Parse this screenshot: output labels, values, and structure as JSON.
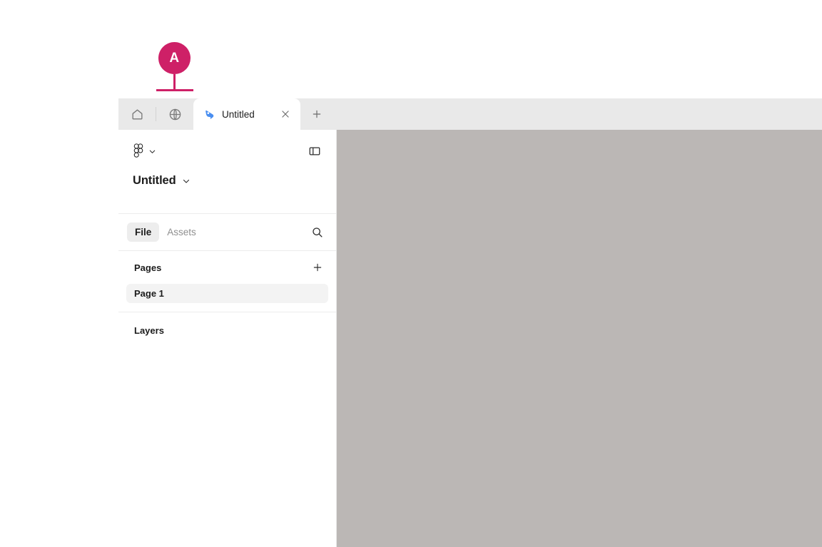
{
  "annotation": {
    "label": "A",
    "color": "#CE2067"
  },
  "browser": {
    "home_icon": "home-icon",
    "globe_icon": "globe-icon",
    "tab": {
      "favicon": "penpot-logo-icon",
      "title": "Untitled",
      "close_icon": "close-icon"
    },
    "new_tab_icon": "plus-icon"
  },
  "sidebar": {
    "brand": {
      "logo_icon": "figma-logo-icon",
      "chevron_icon": "chevron-down-icon"
    },
    "panel_toggle_icon": "panel-left-toggle-icon",
    "file": {
      "name": "Untitled",
      "chevron_icon": "chevron-down-icon"
    },
    "tabs": [
      {
        "label": "File",
        "active": true
      },
      {
        "label": "Assets",
        "active": false
      }
    ],
    "search_icon": "search-icon",
    "pages": {
      "title": "Pages",
      "add_icon": "plus-icon",
      "items": [
        {
          "label": "Page 1",
          "selected": true
        }
      ]
    },
    "layers": {
      "title": "Layers",
      "items": []
    }
  },
  "canvas": {
    "background_color": "#BBB7B5"
  },
  "colors": {
    "accent_pink": "#CE2067",
    "tab_strip": "#E9E9E9",
    "canvas_gray": "#BBB7B5",
    "selected_row": "#F3F3F3"
  }
}
